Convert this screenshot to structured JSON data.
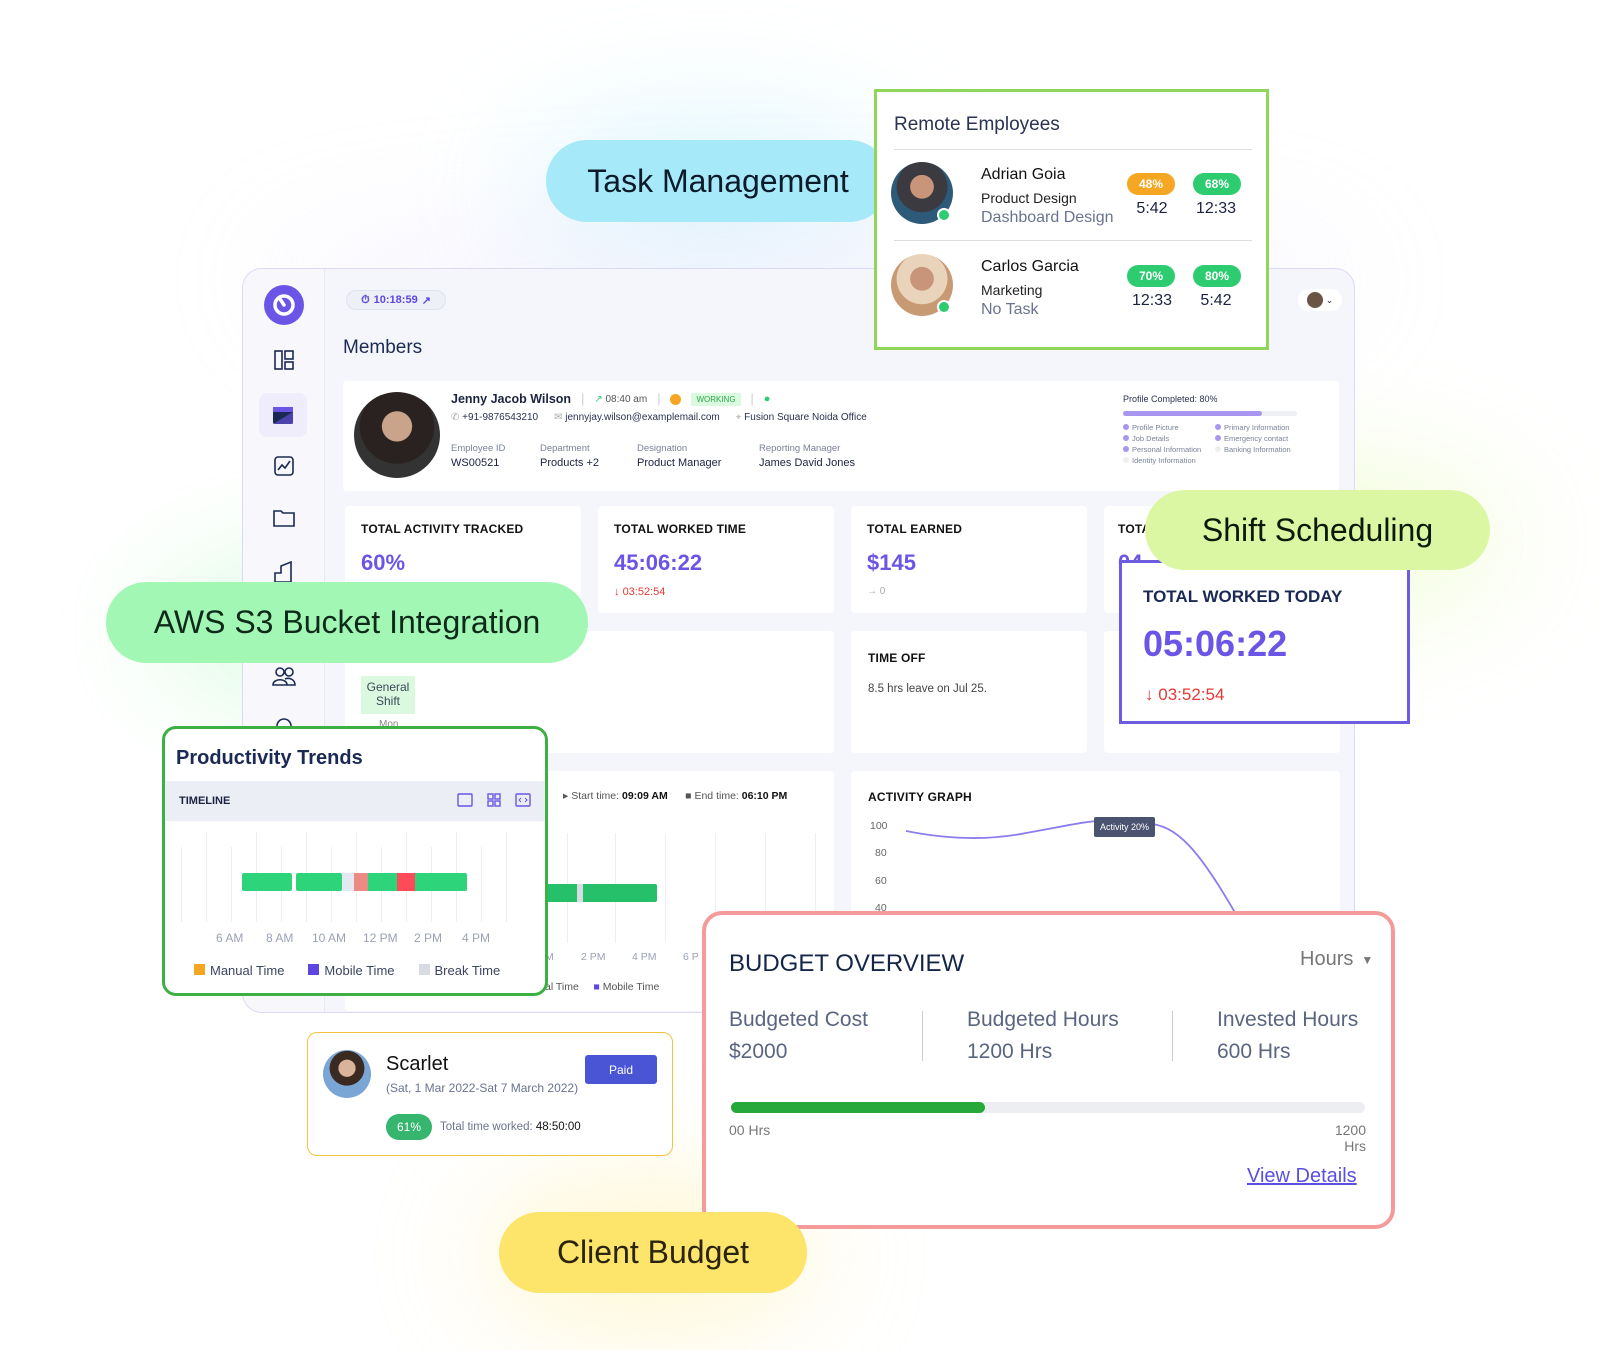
{
  "colors": {
    "accent": "#6a55e6",
    "green": "#2ecc71",
    "red": "#ff4757"
  },
  "topbar": {
    "timer": "10:18:59"
  },
  "page_title": "Members",
  "sidebar": {
    "icons": [
      "logo-timer-icon",
      "dashboard-icon",
      "calendar-icon",
      "chart-icon",
      "folder-icon",
      "building-icon",
      "team-icon",
      "settings-icon"
    ]
  },
  "profile": {
    "name": "Jenny Jacob Wilson",
    "time": "08:40 am",
    "status": "WORKING",
    "phone": "+91-9876543210",
    "email": "jennyjay.wilson@examplemail.com",
    "location": "Fusion Square Noida Office",
    "fields": [
      {
        "label": "Employee ID",
        "value": "WS00521"
      },
      {
        "label": "Department",
        "value": "Products +2"
      },
      {
        "label": "Designation",
        "value": "Product Manager"
      },
      {
        "label": "Reporting Manager",
        "value": "James David Jones"
      }
    ],
    "completion_label": "Profile Completed: 80%",
    "completion": 80,
    "checklist": [
      {
        "label": "Profile Picture",
        "done": true
      },
      {
        "label": "Primary Information",
        "done": true
      },
      {
        "label": "Job Details",
        "done": true
      },
      {
        "label": "Emergency contact",
        "done": true
      },
      {
        "label": "Personal Information",
        "done": true
      },
      {
        "label": "Banking Information",
        "done": false
      },
      {
        "label": "Identity Information",
        "done": false
      }
    ]
  },
  "stats": [
    {
      "title": "TOTAL ACTIVITY TRACKED",
      "value": "60%"
    },
    {
      "title": "TOTAL WORKED TIME",
      "value": "45:06:22",
      "delta": "03:52:54"
    },
    {
      "title": "TOTAL EARNED",
      "value": "$145",
      "delta": "0"
    },
    {
      "title": "TOTA",
      "value": "04"
    }
  ],
  "shift": {
    "chip": "General Shift",
    "day": "Mon"
  },
  "time_off": {
    "title": "TIME OFF",
    "text": "8.5 hrs leave on Jul 25."
  },
  "timeline_bg": {
    "start_label": "Start time:",
    "start": "09:09 AM",
    "end_label": "End time:",
    "end": "06:10 PM",
    "ticks": [
      "M",
      "2 PM",
      "4 PM",
      "6 P"
    ],
    "legend": [
      "al Time",
      "Mobile Time"
    ]
  },
  "activity": {
    "title": "ACTIVITY GRAPH",
    "yticks": [
      "100",
      "80",
      "60",
      "40"
    ],
    "tooltip": "Activity 20%"
  },
  "chart_data": {
    "type": "line",
    "title": "ACTIVITY GRAPH",
    "yticks": [
      100,
      80,
      60,
      40
    ],
    "tooltip": "Activity 20%"
  },
  "remote": {
    "title": "Remote Employees",
    "employees": [
      {
        "name": "Adrian Goia",
        "dept": "Product Design",
        "task": "Dashboard Design",
        "p1": "48%",
        "t1": "5:42",
        "p2": "68%",
        "t2": "12:33",
        "c1": "#f5a623",
        "c2": "#2ecc71"
      },
      {
        "name": "Carlos Garcia",
        "dept": "Marketing",
        "task": "No Task",
        "p1": "70%",
        "t1": "12:33",
        "p2": "80%",
        "t2": "5:42",
        "c1": "#2ecc71",
        "c2": "#2ecc71"
      }
    ]
  },
  "pills": {
    "task": "Task Management",
    "shift": "Shift Scheduling",
    "aws": "AWS S3 Bucket Integration",
    "budget": "Client Budget"
  },
  "today": {
    "title": "TOTAL WORKED TODAY",
    "value": "05:06:22",
    "delta": "03:52:54"
  },
  "productivity": {
    "title": "Productivity Trends",
    "tab": "TIMELINE",
    "ticks": [
      "6 AM",
      "8 AM",
      "10 AM",
      "12 PM",
      "2 PM",
      "4 PM"
    ],
    "legend": [
      {
        "label": "Manual Time",
        "color": "#f5a623"
      },
      {
        "label": "Mobile Time",
        "color": "#5b47e0"
      },
      {
        "label": "Break Time",
        "color": "#d8dbe2"
      }
    ]
  },
  "scarlet": {
    "name": "Scarlet",
    "range": "(Sat, 1 Mar 2022-Sat 7 March 2022)",
    "status": "Paid",
    "percent": "61%",
    "worked_label": "Total time worked:",
    "worked": "48:50:00"
  },
  "budget": {
    "title": "BUDGET OVERVIEW",
    "unit": "Hours",
    "cols": [
      {
        "label": "Budgeted Cost",
        "value": "$2000"
      },
      {
        "label": "Budgeted Hours",
        "value": "1200 Hrs"
      },
      {
        "label": "Invested Hours",
        "value": "600 Hrs"
      }
    ],
    "progress": 40,
    "min": "00 Hrs",
    "max": "1200",
    "max_unit": "Hrs",
    "link": "View Details"
  }
}
